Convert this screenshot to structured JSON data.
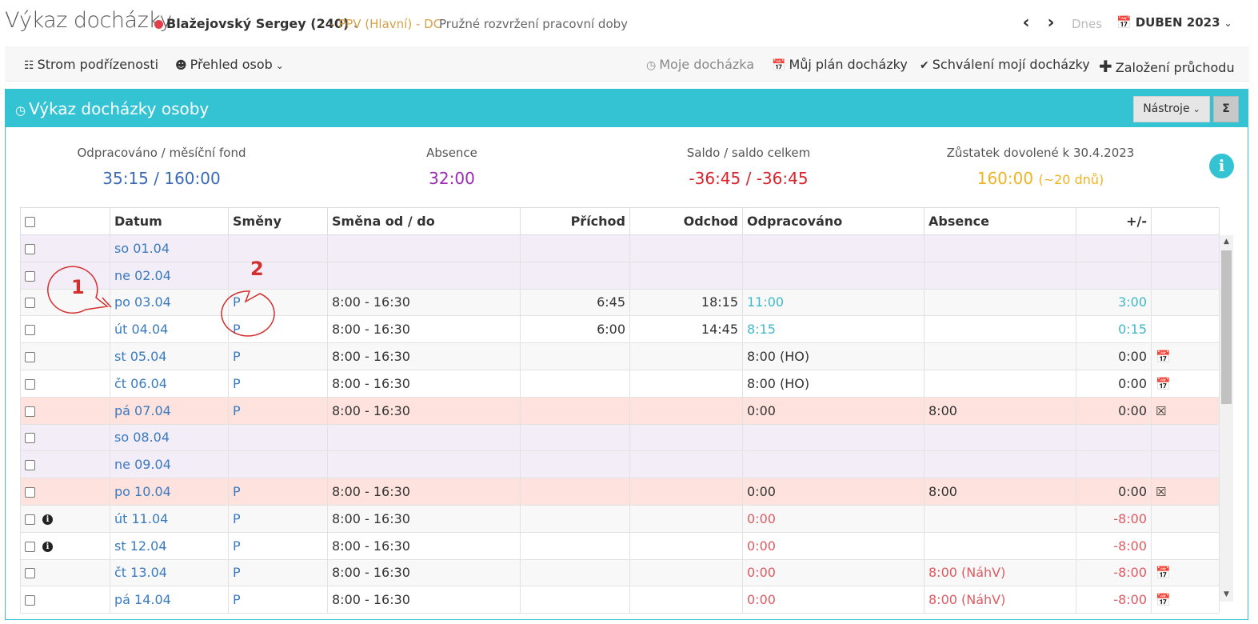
{
  "header": {
    "title": "Výkaz docházky",
    "person": "Blažejovský Sergey (240)",
    "contract": "- PPV (Hlavní) - DC",
    "work_mode": "Pružné rozvržení pracovní doby",
    "today_label": "Dnes",
    "month": "DUBEN 2023",
    "status_color": "#e0404a"
  },
  "toolbar": {
    "subordinate_tree": "Strom podřízenosti",
    "people_overview": "Přehled osob",
    "my_attendance": "Moje docházka",
    "my_plan": "Můj plán docházky",
    "my_approval": "Schválení mojí docházky",
    "create_pass": "Založení průchodu"
  },
  "panel": {
    "title": "Výkaz docházky osoby",
    "tools_label": "Nástroje",
    "sigma_label": "Σ"
  },
  "stats": {
    "worked": {
      "label": "Odpracováno / měsíční fond",
      "value": "35:15 / 160:00",
      "color": "#3a6ab6"
    },
    "absence": {
      "label": "Absence",
      "value": "32:00",
      "color": "#9a2bb3"
    },
    "balance": {
      "label": "Saldo / saldo celkem",
      "value": "-36:45 / -36:45",
      "color": "#d9232d"
    },
    "vacation": {
      "label": "Zůstatek dovolené k 30.4.2023",
      "value": "160:00",
      "extra": "(~20 dnů)",
      "color": "#f0b323"
    }
  },
  "table": {
    "columns": [
      "Datum",
      "Směny",
      "Směna od / do",
      "Příchod",
      "Odchod",
      "Odpracováno",
      "Absence",
      "+/-"
    ],
    "rows": [
      {
        "date": "so 01.04",
        "shift": "",
        "range": "",
        "arrival": "",
        "departure": "",
        "worked": "",
        "absence": "",
        "diff": "",
        "type": "weekend"
      },
      {
        "date": "ne 02.04",
        "shift": "",
        "range": "",
        "arrival": "",
        "departure": "",
        "worked": "",
        "absence": "",
        "diff": "",
        "type": "weekend"
      },
      {
        "date": "po 03.04",
        "shift": "P",
        "range": "8:00 - 16:30",
        "arrival": "6:45",
        "departure": "18:15",
        "worked": "11:00",
        "absence": "",
        "diff": "3:00",
        "type": "alt",
        "tone": "teal"
      },
      {
        "date": "út 04.04",
        "shift": "P",
        "range": "8:00 - 16:30",
        "arrival": "6:00",
        "departure": "14:45",
        "worked": "8:15",
        "absence": "",
        "diff": "0:15",
        "type": "plain",
        "tone": "teal"
      },
      {
        "date": "st 05.04",
        "shift": "P",
        "range": "8:00 - 16:30",
        "arrival": "",
        "departure": "",
        "worked": "8:00 (HO)",
        "absence": "",
        "diff": "0:00",
        "type": "alt",
        "icon": "calendar-icon"
      },
      {
        "date": "čt 06.04",
        "shift": "P",
        "range": "8:00 - 16:30",
        "arrival": "",
        "departure": "",
        "worked": "8:00 (HO)",
        "absence": "",
        "diff": "0:00",
        "type": "plain",
        "icon": "calendar-icon"
      },
      {
        "date": "pá 07.04",
        "shift": "P",
        "range": "8:00 - 16:30",
        "arrival": "",
        "departure": "",
        "worked": "0:00",
        "absence": "8:00",
        "diff": "0:00",
        "type": "holiday",
        "icon": "calendar-x-icon"
      },
      {
        "date": "so 08.04",
        "shift": "",
        "range": "",
        "arrival": "",
        "departure": "",
        "worked": "",
        "absence": "",
        "diff": "",
        "type": "weekend"
      },
      {
        "date": "ne 09.04",
        "shift": "",
        "range": "",
        "arrival": "",
        "departure": "",
        "worked": "",
        "absence": "",
        "diff": "",
        "type": "weekend"
      },
      {
        "date": "po 10.04",
        "shift": "P",
        "range": "8:00 - 16:30",
        "arrival": "",
        "departure": "",
        "worked": "0:00",
        "absence": "8:00",
        "diff": "0:00",
        "type": "holiday",
        "icon": "calendar-x-icon"
      },
      {
        "date": "út 11.04",
        "shift": "P",
        "range": "8:00 - 16:30",
        "arrival": "",
        "departure": "",
        "worked": "0:00",
        "absence": "",
        "diff": "-8:00",
        "type": "alt",
        "tone": "red",
        "info": true
      },
      {
        "date": "st 12.04",
        "shift": "P",
        "range": "8:00 - 16:30",
        "arrival": "",
        "departure": "",
        "worked": "0:00",
        "absence": "",
        "diff": "-8:00",
        "type": "plain",
        "tone": "red",
        "info": true
      },
      {
        "date": "čt 13.04",
        "shift": "P",
        "range": "8:00 - 16:30",
        "arrival": "",
        "departure": "",
        "worked": "0:00",
        "absence": "8:00 (NáhV)",
        "diff": "-8:00",
        "type": "alt",
        "tone": "red",
        "icon": "calendar-icon"
      },
      {
        "date": "pá 14.04",
        "shift": "P",
        "range": "8:00 - 16:30",
        "arrival": "",
        "departure": "",
        "worked": "0:00",
        "absence": "8:00 (NáhV)",
        "diff": "-8:00",
        "type": "plain",
        "tone": "red",
        "icon": "calendar-icon"
      }
    ]
  },
  "annotations": {
    "callout_1": "1",
    "callout_2": "2"
  }
}
